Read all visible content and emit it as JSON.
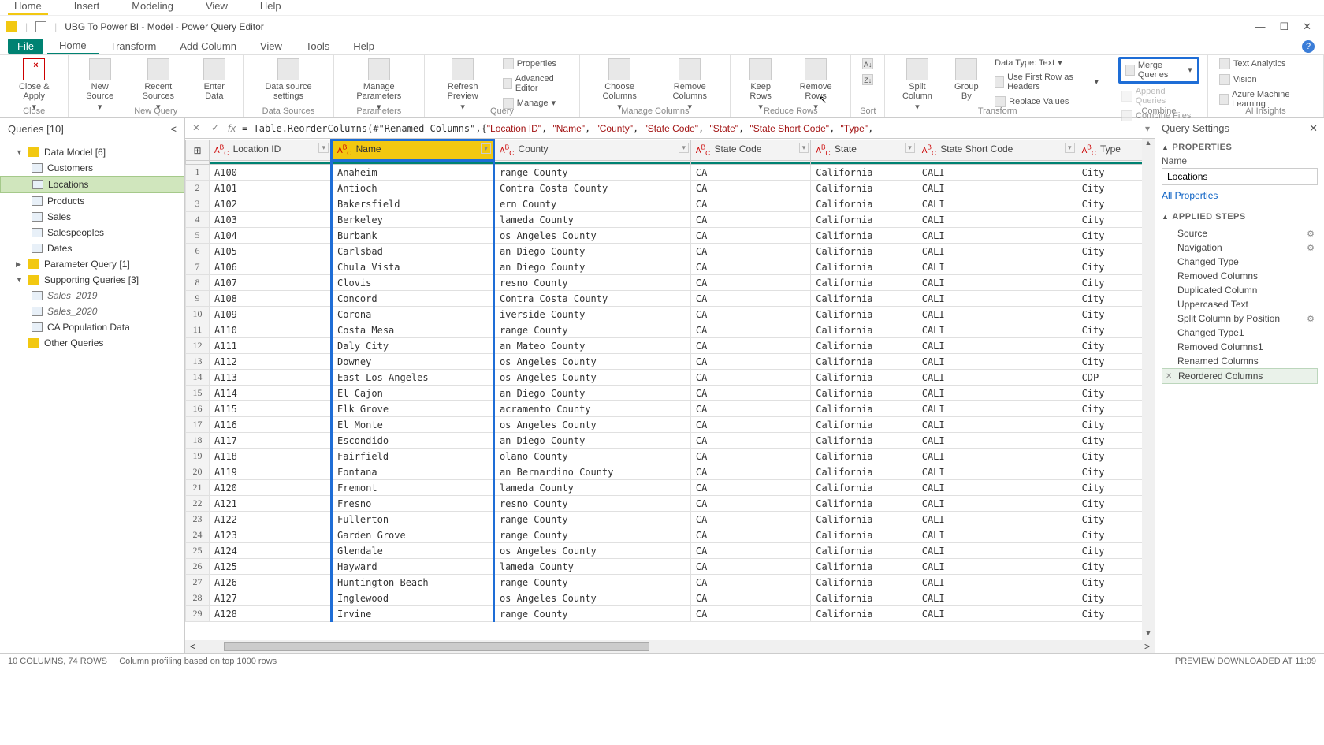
{
  "topMenu": [
    "Home",
    "Insert",
    "Modeling",
    "View",
    "Help"
  ],
  "titleBar": {
    "text": "UBG To Power BI - Model - Power Query Editor"
  },
  "ribbonTabs": {
    "file": "File",
    "tabs": [
      "Home",
      "Transform",
      "Add Column",
      "View",
      "Tools",
      "Help"
    ]
  },
  "ribbon": {
    "close": {
      "btn": "Close &\nApply",
      "group": "Close"
    },
    "newQuery": {
      "b1": "New\nSource",
      "b2": "Recent\nSources",
      "b3": "Enter\nData",
      "group": "New Query"
    },
    "dataSources": {
      "b1": "Data source\nsettings",
      "group": "Data Sources"
    },
    "parameters": {
      "b1": "Manage\nParameters",
      "group": "Parameters"
    },
    "query": {
      "b1": "Refresh\nPreview",
      "s1": "Properties",
      "s2": "Advanced Editor",
      "s3": "Manage",
      "group": "Query"
    },
    "manageColumns": {
      "b1": "Choose\nColumns",
      "b2": "Remove\nColumns",
      "group": "Manage Columns"
    },
    "reduceRows": {
      "b1": "Keep\nRows",
      "b2": "Remove\nRows",
      "group": "Reduce Rows"
    },
    "sort": {
      "group": "Sort"
    },
    "transform": {
      "b1": "Split\nColumn",
      "b2": "Group\nBy",
      "s1": "Data Type: Text",
      "s2": "Use First Row as Headers",
      "s3": "Replace Values",
      "group": "Transform"
    },
    "combine": {
      "s1": "Merge Queries",
      "s2": "Append Queries",
      "s3": "Combine Files",
      "group": "Combine"
    },
    "ai": {
      "s1": "Text Analytics",
      "s2": "Vision",
      "s3": "Azure Machine Learning",
      "group": "AI Insights"
    }
  },
  "queriesPanel": {
    "header": "Queries [10]",
    "dataModel": {
      "label": "Data Model [6]",
      "items": [
        "Customers",
        "Locations",
        "Products",
        "Sales",
        "Salespeoples",
        "Dates"
      ]
    },
    "paramQuery": "Parameter Query [1]",
    "supporting": {
      "label": "Supporting Queries [3]",
      "items": [
        "Sales_2019",
        "Sales_2020",
        "CA Population Data"
      ]
    },
    "other": "Other Queries"
  },
  "formulaBar": {
    "prefix": "= Table.ReorderColumns(#\"Renamed Columns\",{",
    "cols": [
      "\"Location ID\"",
      "\"Name\"",
      "\"County\"",
      "\"State Code\"",
      "\"State\"",
      "\"State Short Code\"",
      "\"Type\""
    ]
  },
  "grid": {
    "headers": [
      "Location ID",
      "Name",
      "County",
      "State Code",
      "State",
      "State Short Code",
      "Type"
    ],
    "rows": [
      [
        "A100",
        "Anaheim",
        "range County",
        "CA",
        "California",
        "CALI",
        "City"
      ],
      [
        "A101",
        "Antioch",
        "Contra Costa County",
        "CA",
        "California",
        "CALI",
        "City"
      ],
      [
        "A102",
        "Bakersfield",
        "ern County",
        "CA",
        "California",
        "CALI",
        "City"
      ],
      [
        "A103",
        "Berkeley",
        "lameda County",
        "CA",
        "California",
        "CALI",
        "City"
      ],
      [
        "A104",
        "Burbank",
        "os Angeles County",
        "CA",
        "California",
        "CALI",
        "City"
      ],
      [
        "A105",
        "Carlsbad",
        "an Diego County",
        "CA",
        "California",
        "CALI",
        "City"
      ],
      [
        "A106",
        "Chula Vista",
        "an Diego County",
        "CA",
        "California",
        "CALI",
        "City"
      ],
      [
        "A107",
        "Clovis",
        "resno County",
        "CA",
        "California",
        "CALI",
        "City"
      ],
      [
        "A108",
        "Concord",
        "Contra Costa County",
        "CA",
        "California",
        "CALI",
        "City"
      ],
      [
        "A109",
        "Corona",
        "iverside County",
        "CA",
        "California",
        "CALI",
        "City"
      ],
      [
        "A110",
        "Costa Mesa",
        "range County",
        "CA",
        "California",
        "CALI",
        "City"
      ],
      [
        "A111",
        "Daly City",
        "an Mateo County",
        "CA",
        "California",
        "CALI",
        "City"
      ],
      [
        "A112",
        "Downey",
        "os Angeles County",
        "CA",
        "California",
        "CALI",
        "City"
      ],
      [
        "A113",
        "East Los Angeles",
        "os Angeles County",
        "CA",
        "California",
        "CALI",
        "CDP"
      ],
      [
        "A114",
        "El Cajon",
        "an Diego County",
        "CA",
        "California",
        "CALI",
        "City"
      ],
      [
        "A115",
        "Elk Grove",
        "acramento County",
        "CA",
        "California",
        "CALI",
        "City"
      ],
      [
        "A116",
        "El Monte",
        "os Angeles County",
        "CA",
        "California",
        "CALI",
        "City"
      ],
      [
        "A117",
        "Escondido",
        "an Diego County",
        "CA",
        "California",
        "CALI",
        "City"
      ],
      [
        "A118",
        "Fairfield",
        "olano County",
        "CA",
        "California",
        "CALI",
        "City"
      ],
      [
        "A119",
        "Fontana",
        "an Bernardino County",
        "CA",
        "California",
        "CALI",
        "City"
      ],
      [
        "A120",
        "Fremont",
        "lameda County",
        "CA",
        "California",
        "CALI",
        "City"
      ],
      [
        "A121",
        "Fresno",
        "resno County",
        "CA",
        "California",
        "CALI",
        "City"
      ],
      [
        "A122",
        "Fullerton",
        "range County",
        "CA",
        "California",
        "CALI",
        "City"
      ],
      [
        "A123",
        "Garden Grove",
        "range County",
        "CA",
        "California",
        "CALI",
        "City"
      ],
      [
        "A124",
        "Glendale",
        "os Angeles County",
        "CA",
        "California",
        "CALI",
        "City"
      ],
      [
        "A125",
        "Hayward",
        "lameda County",
        "CA",
        "California",
        "CALI",
        "City"
      ],
      [
        "A126",
        "Huntington Beach",
        "range County",
        "CA",
        "California",
        "CALI",
        "City"
      ],
      [
        "A127",
        "Inglewood",
        "os Angeles County",
        "CA",
        "California",
        "CALI",
        "City"
      ],
      [
        "A128",
        "Irvine",
        "range County",
        "CA",
        "California",
        "CALI",
        "City"
      ]
    ]
  },
  "querySettings": {
    "title": "Query Settings",
    "propLabel": "PROPERTIES",
    "nameLabel": "Name",
    "nameValue": "Locations",
    "allProps": "All Properties",
    "stepsLabel": "APPLIED STEPS",
    "steps": [
      {
        "t": "Source",
        "gear": true
      },
      {
        "t": "Navigation",
        "gear": true
      },
      {
        "t": "Changed Type",
        "gear": false
      },
      {
        "t": "Removed Columns",
        "gear": false
      },
      {
        "t": "Duplicated Column",
        "gear": false
      },
      {
        "t": "Uppercased Text",
        "gear": false
      },
      {
        "t": "Split Column by Position",
        "gear": true
      },
      {
        "t": "Changed Type1",
        "gear": false
      },
      {
        "t": "Removed Columns1",
        "gear": false
      },
      {
        "t": "Renamed Columns",
        "gear": false
      },
      {
        "t": "Reordered Columns",
        "gear": false,
        "sel": true
      }
    ]
  },
  "statusBar": {
    "left": "10 COLUMNS, 74 ROWS",
    "mid": "Column profiling based on top 1000 rows",
    "right": "PREVIEW DOWNLOADED AT 11:09"
  }
}
